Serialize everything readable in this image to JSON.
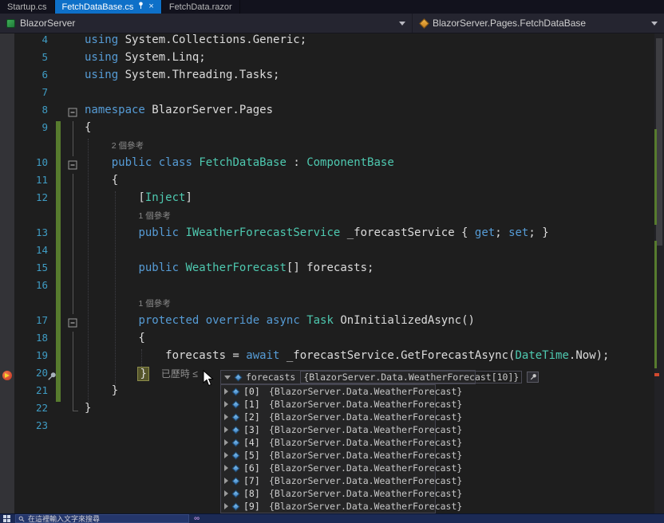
{
  "tabs": [
    {
      "label": "Startup.cs"
    },
    {
      "label": "FetchDataBase.cs"
    },
    {
      "label": "FetchData.razor"
    }
  ],
  "navbar": {
    "project": "BlazorServer",
    "type_path": "BlazorServer.Pages.FetchDataBase"
  },
  "editor": {
    "colors": {
      "background": "#1E1E1E",
      "gutter": "#333337",
      "keyword": "#569CD6",
      "type": "#4EC9B0",
      "text": "#DCDCDC",
      "line_number": "#3F9CC4",
      "codelens": "#8A8A8A",
      "change_bar": "#577B2E",
      "breakpoint": "#C22E1E",
      "current_statement_box": "#55552B",
      "active_tab": "#0E70C8"
    },
    "lines": [
      {
        "n": "4",
        "seg": [
          [
            "kw",
            "using"
          ],
          [
            "pl",
            " System.Collections.Generic;"
          ]
        ]
      },
      {
        "n": "5",
        "seg": [
          [
            "kw",
            "using"
          ],
          [
            "pl",
            " System.Linq;"
          ]
        ]
      },
      {
        "n": "6",
        "seg": [
          [
            "kw",
            "using"
          ],
          [
            "pl",
            " System.Threading.Tasks;"
          ]
        ]
      },
      {
        "n": "7",
        "seg": []
      },
      {
        "n": "8",
        "ol": "box",
        "seg": [
          [
            "kw",
            "namespace"
          ],
          [
            "pl",
            " BlazorServer.Pages"
          ]
        ]
      },
      {
        "n": "9",
        "ol": "v",
        "chg": true,
        "seg": [
          [
            "pl",
            "{"
          ]
        ]
      },
      {
        "lens": "2 個參考",
        "pad": "    ",
        "ol": "v",
        "chg": true
      },
      {
        "n": "10",
        "ol": "box",
        "chg": true,
        "seg": [
          [
            "pl",
            "    "
          ],
          [
            "kw",
            "public"
          ],
          [
            "pl",
            " "
          ],
          [
            "kw",
            "class"
          ],
          [
            "pl",
            " "
          ],
          [
            "ty",
            "FetchDataBase"
          ],
          [
            "pl",
            " : "
          ],
          [
            "ty",
            "ComponentBase"
          ]
        ]
      },
      {
        "n": "11",
        "ol": "v",
        "chg": true,
        "seg": [
          [
            "pl",
            "    {"
          ]
        ]
      },
      {
        "n": "12",
        "ol": "v",
        "chg": true,
        "seg": [
          [
            "pl",
            "        ["
          ],
          [
            "ty",
            "Inject"
          ],
          [
            "pl",
            "]"
          ]
        ]
      },
      {
        "lens": "1 個參考",
        "pad": "        ",
        "ol": "v",
        "chg": true
      },
      {
        "n": "13",
        "ol": "v",
        "chg": true,
        "seg": [
          [
            "pl",
            "        "
          ],
          [
            "kw",
            "public"
          ],
          [
            "pl",
            " "
          ],
          [
            "ty",
            "IWeatherForecastService"
          ],
          [
            "pl",
            " _forecastService { "
          ],
          [
            "kw",
            "get"
          ],
          [
            "pl",
            "; "
          ],
          [
            "kw",
            "set"
          ],
          [
            "pl",
            "; }"
          ]
        ]
      },
      {
        "n": "14",
        "ol": "v",
        "chg": true,
        "seg": []
      },
      {
        "n": "15",
        "ol": "v",
        "chg": true,
        "seg": [
          [
            "pl",
            "        "
          ],
          [
            "kw",
            "public"
          ],
          [
            "pl",
            " "
          ],
          [
            "ty",
            "WeatherForecast"
          ],
          [
            "pl",
            "[] forecasts;"
          ]
        ]
      },
      {
        "n": "16",
        "ol": "v",
        "chg": true,
        "seg": []
      },
      {
        "lens": "1 個參考",
        "pad": "        ",
        "ol": "v",
        "chg": true
      },
      {
        "n": "17",
        "ol": "box",
        "chg": true,
        "seg": [
          [
            "pl",
            "        "
          ],
          [
            "kw",
            "protected"
          ],
          [
            "pl",
            " "
          ],
          [
            "kw",
            "override"
          ],
          [
            "pl",
            " "
          ],
          [
            "kw",
            "async"
          ],
          [
            "pl",
            " "
          ],
          [
            "ty",
            "Task"
          ],
          [
            "pl",
            " OnInitializedAsync()"
          ]
        ]
      },
      {
        "n": "18",
        "ol": "v",
        "chg": true,
        "seg": [
          [
            "pl",
            "        {"
          ]
        ]
      },
      {
        "n": "19",
        "ol": "v",
        "chg": true,
        "seg": [
          [
            "pl",
            "            forecasts = "
          ],
          [
            "kw",
            "await"
          ],
          [
            "pl",
            " _forecastService.GetForecastAsync("
          ],
          [
            "ty",
            "DateTime"
          ],
          [
            "pl",
            ".Now);"
          ]
        ]
      },
      {
        "n": "20",
        "ol": "v",
        "chg": true,
        "bp": true,
        "pin": true,
        "seg": [
          [
            "pl",
            "        "
          ],
          [
            "cur",
            "}"
          ]
        ],
        "perftip": "已歷時 ≤"
      },
      {
        "n": "21",
        "ol": "v",
        "chg": true,
        "seg": [
          [
            "pl",
            "    }"
          ]
        ]
      },
      {
        "n": "22",
        "ol": "end",
        "seg": [
          [
            "pl",
            "}"
          ]
        ]
      },
      {
        "n": "23",
        "seg": []
      }
    ]
  },
  "datatip": {
    "root": {
      "name": "forecasts",
      "value": "{BlazorServer.Data.WeatherForecast[10]}"
    },
    "items": [
      {
        "name": "[0]",
        "value": "{BlazorServer.Data.WeatherForecast}"
      },
      {
        "name": "[1]",
        "value": "{BlazorServer.Data.WeatherForecast}"
      },
      {
        "name": "[2]",
        "value": "{BlazorServer.Data.WeatherForecast}"
      },
      {
        "name": "[3]",
        "value": "{BlazorServer.Data.WeatherForecast}"
      },
      {
        "name": "[4]",
        "value": "{BlazorServer.Data.WeatherForecast}"
      },
      {
        "name": "[5]",
        "value": "{BlazorServer.Data.WeatherForecast}"
      },
      {
        "name": "[6]",
        "value": "{BlazorServer.Data.WeatherForecast}"
      },
      {
        "name": "[7]",
        "value": "{BlazorServer.Data.WeatherForecast}"
      },
      {
        "name": "[8]",
        "value": "{BlazorServer.Data.WeatherForecast}"
      },
      {
        "name": "[9]",
        "value": "{BlazorServer.Data.WeatherForecast}"
      }
    ]
  },
  "taskbar": {
    "search_placeholder": "在這裡輸入文字來搜尋"
  }
}
